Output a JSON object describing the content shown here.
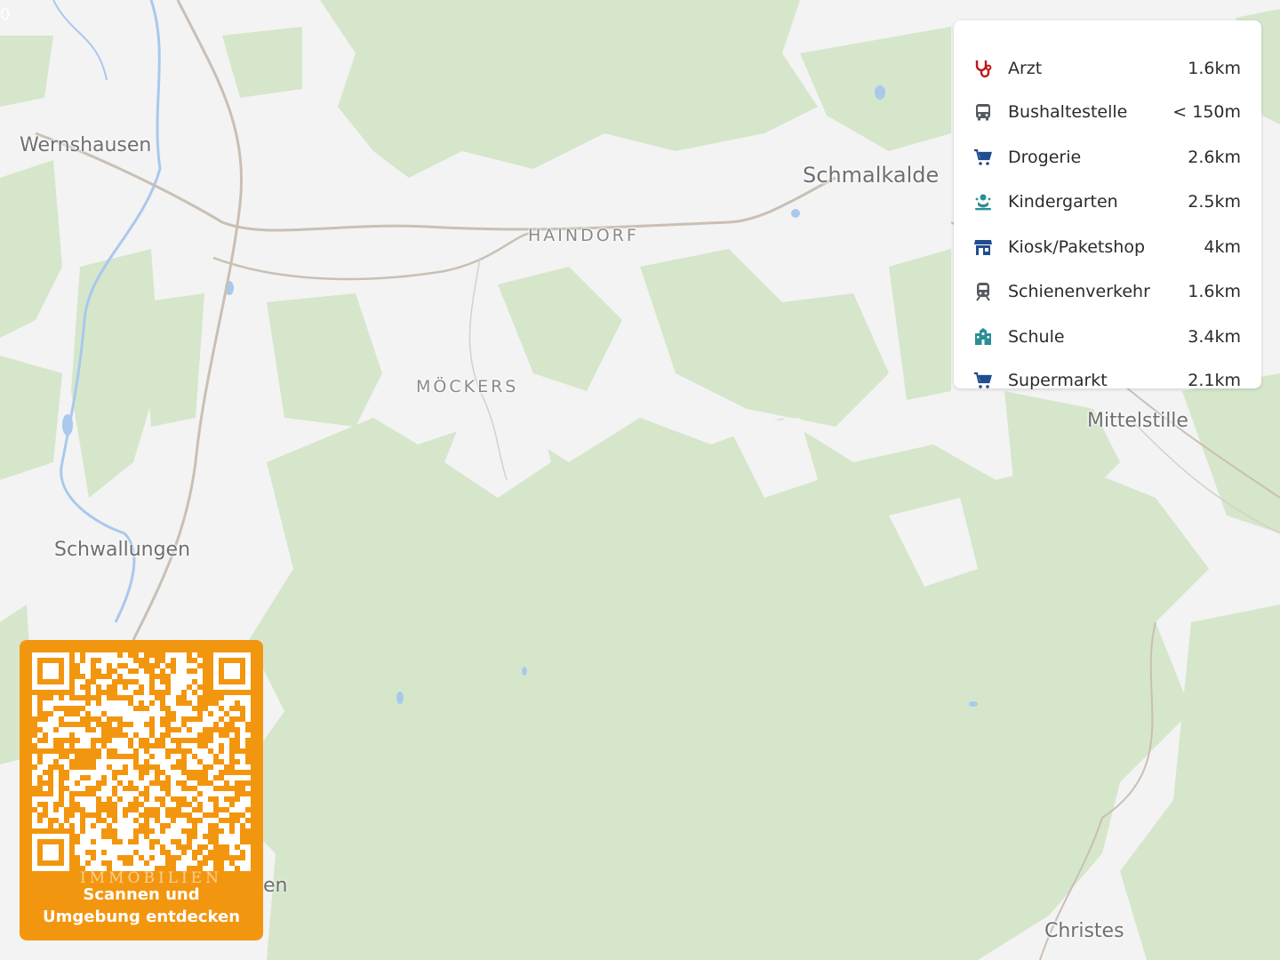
{
  "map": {
    "places": {
      "wernshausen": "Wernshausen",
      "schmalkalden": "Schmalkalde",
      "haindorf": "HAINDORF",
      "moeckers": "MÖCKERS",
      "mittelstille": "Mittelstille",
      "schwallungen": "Schwallungen",
      "christes": "Christes",
      "partial_town": "en"
    },
    "edge_marker": "0",
    "colors": {
      "land": "#f3f3f3",
      "forest": "#d5e6cb",
      "forest_dark": "#c9dfbf",
      "water": "#a9c8ee",
      "road": "#c9bfb4"
    }
  },
  "poi_panel": {
    "items": [
      {
        "label": "Arzt",
        "distance": "1.6km",
        "icon": "stethoscope-icon",
        "color": "#c5141a"
      },
      {
        "label": "Bushaltestelle",
        "distance": "< 150m",
        "icon": "bus-icon",
        "color": "#555a60"
      },
      {
        "label": "Drogerie",
        "distance": "2.6km",
        "icon": "cart-icon",
        "color": "#1f4d8f"
      },
      {
        "label": "Kindergarten",
        "distance": "2.5km",
        "icon": "kindergarten-icon",
        "color": "#2a8f95"
      },
      {
        "label": "Kiosk/Paketshop",
        "distance": "4km",
        "icon": "shop-icon",
        "color": "#1f4d8f"
      },
      {
        "label": "Schienenverkehr",
        "distance": "1.6km",
        "icon": "train-icon",
        "color": "#555a60"
      },
      {
        "label": "Schule",
        "distance": "3.4km",
        "icon": "school-icon",
        "color": "#2a8f95"
      },
      {
        "label": "Supermarkt",
        "distance": "2.1km",
        "icon": "cart-icon",
        "color": "#1f4d8f"
      }
    ]
  },
  "qr_card": {
    "caption_line1": "Scannen und",
    "caption_line2": "Umgebung entdecken",
    "watermark": "IMMOBILIEN",
    "accent": "#f3960f"
  }
}
